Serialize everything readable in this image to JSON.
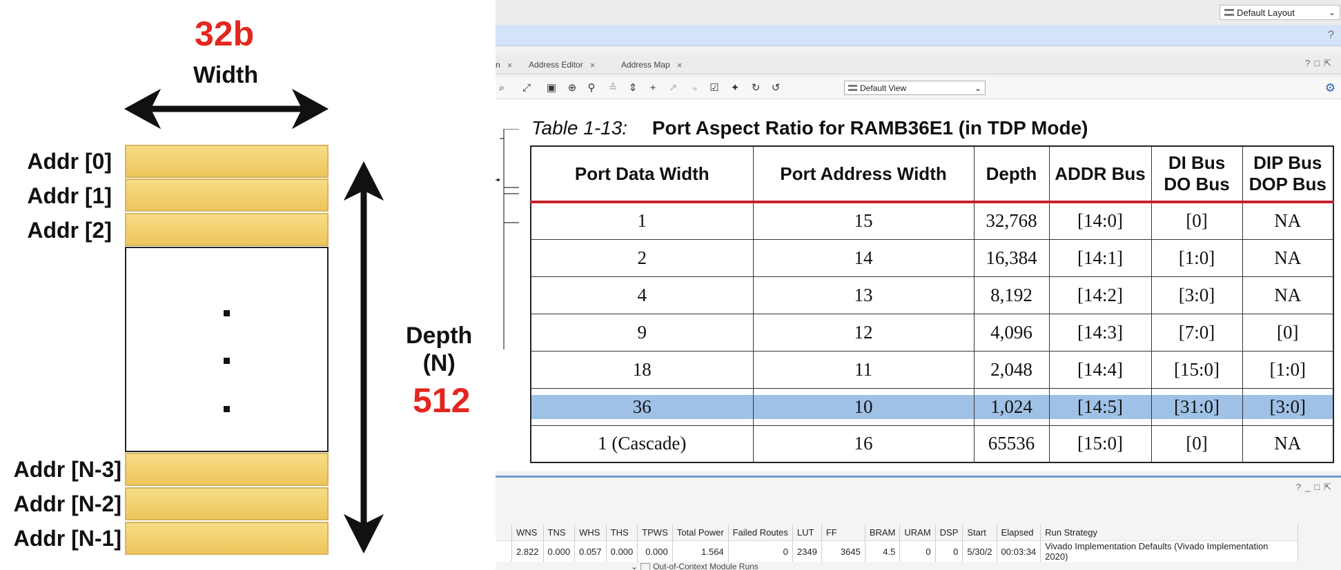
{
  "slide": {
    "width_bits": "32b",
    "width_label": "Width",
    "depth_label_line1": "Depth",
    "depth_label_line2": "(N)",
    "depth_value": "512",
    "addr_labels": [
      "Addr [0]",
      "Addr [1]",
      "Addr [2]",
      "Addr [N-3]",
      "Addr [N-2]",
      "Addr [N-1]"
    ],
    "colors": {
      "accent_red": "#e3261f",
      "memory_fill": "#f2d070"
    }
  },
  "ide": {
    "layout_select": "Default Layout",
    "help": "?",
    "tabs": [
      {
        "label": "Address Editor"
      },
      {
        "label": "Address Map"
      }
    ],
    "tab_fragment": "n",
    "view_select": "Default View",
    "toolbar_icons": [
      "zoom-fit-icon",
      "fit-selection-icon",
      "auto-connect-icon",
      "search-icon",
      "collapse-icon",
      "expand-icon",
      "add-ip-icon",
      "pointer-icon",
      "wrench-icon",
      "validate-icon",
      "pin-icon",
      "refresh-icon",
      "regenerate-icon"
    ]
  },
  "doc_table": {
    "title_index": "Table 1-13:",
    "title_text": "Port Aspect Ratio for RAMB36E1 (in TDP Mode)",
    "headers": [
      "Port Data Width",
      "Port Address Width",
      "Depth",
      "ADDR Bus",
      "DI Bus DO Bus",
      "DIP Bus DOP Bus"
    ],
    "rows": [
      [
        "1",
        "15",
        "32,768",
        "[14:0]",
        "[0]",
        "NA"
      ],
      [
        "2",
        "14",
        "16,384",
        "[14:1]",
        "[1:0]",
        "NA"
      ],
      [
        "4",
        "13",
        "8,192",
        "[14:2]",
        "[3:0]",
        "NA"
      ],
      [
        "9",
        "12",
        "4,096",
        "[14:3]",
        "[7:0]",
        "[0]"
      ],
      [
        "18",
        "11",
        "2,048",
        "[14:4]",
        "[15:0]",
        "[1:0]"
      ],
      [
        "36",
        "10",
        "1,024",
        "[14:5]",
        "[31:0]",
        "[3:0]"
      ],
      [
        "1 (Cascade)",
        "16",
        "65536",
        "[15:0]",
        "[0]",
        "NA"
      ]
    ],
    "highlight_color": "#9fc1e6"
  },
  "runs": {
    "headers": [
      "WNS",
      "TNS",
      "WHS",
      "THS",
      "TPWS",
      "Total Power",
      "Failed Routes",
      "LUT",
      "FF",
      "BRAM",
      "URAM",
      "DSP",
      "Start",
      "Elapsed",
      "Run Strategy"
    ],
    "row": [
      "2.822",
      "0.000",
      "0.057",
      "0.000",
      "0.000",
      "1.564",
      "0",
      "2349",
      "3645",
      "4.5",
      "0",
      "0",
      "5/30/2",
      "00:03:34",
      "Vivado Implementation Defaults (Vivado Implementation 2020)"
    ],
    "tree_item": "Out-of-Context Module Runs"
  }
}
